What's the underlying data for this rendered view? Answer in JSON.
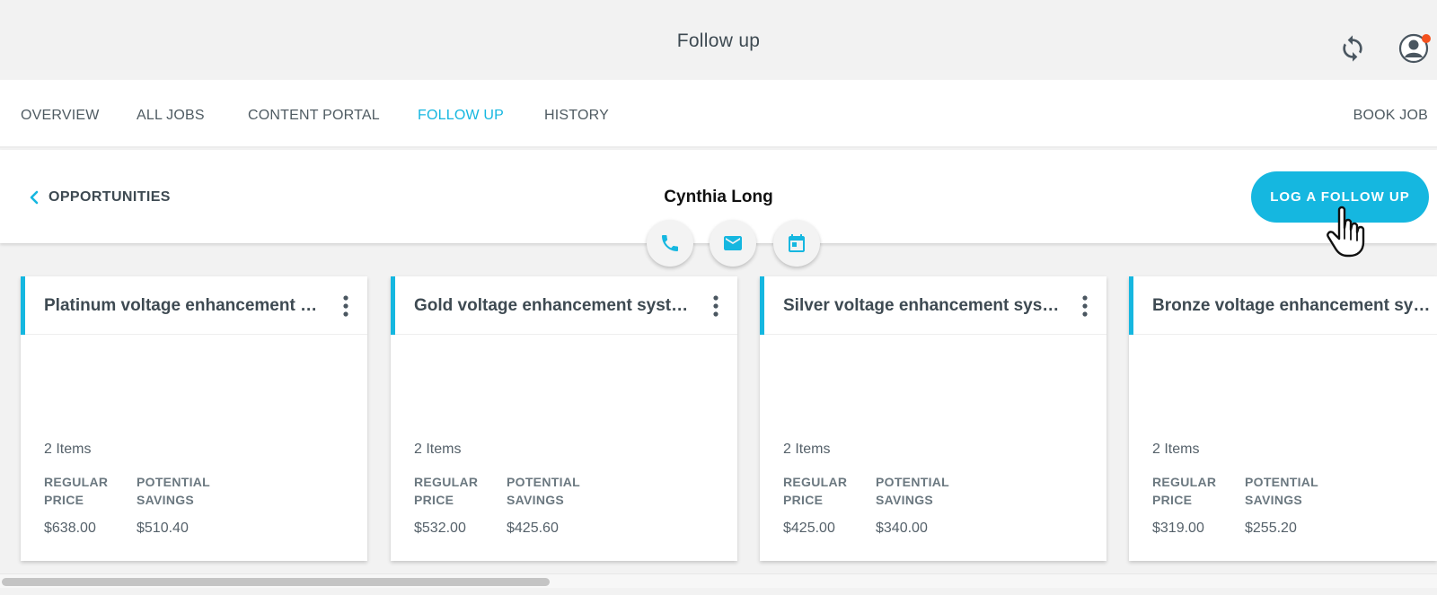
{
  "header": {
    "title": "Follow up"
  },
  "nav": {
    "items": [
      {
        "label": "OVERVIEW"
      },
      {
        "label": "ALL JOBS"
      },
      {
        "label": "CONTENT PORTAL"
      },
      {
        "label": "FOLLOW UP"
      },
      {
        "label": "HISTORY"
      }
    ],
    "active": "FOLLOW UP",
    "book_job": "BOOK JOB"
  },
  "subheader": {
    "back_label": "OPPORTUNITIES",
    "name": "Cynthia Long",
    "log_button": "LOG A FOLLOW UP"
  },
  "actions": [
    "phone-icon",
    "email-icon",
    "calendar-icon"
  ],
  "cards": [
    {
      "title": "Platinum voltage enhancement system",
      "items": "2 Items",
      "regular_label": "REGULAR PRICE",
      "savings_label": "POTENTIAL SAVINGS",
      "regular": "$638.00",
      "savings": "$510.40"
    },
    {
      "title": "Gold voltage enhancement system",
      "items": "2 Items",
      "regular_label": "REGULAR PRICE",
      "savings_label": "POTENTIAL SAVINGS",
      "regular": "$532.00",
      "savings": "$425.60"
    },
    {
      "title": "Silver voltage enhancement system",
      "items": "2 Items",
      "regular_label": "REGULAR PRICE",
      "savings_label": "POTENTIAL SAVINGS",
      "regular": "$425.00",
      "savings": "$340.00"
    },
    {
      "title": "Bronze voltage enhancement system",
      "items": "2 Items",
      "regular_label": "REGULAR PRICE",
      "savings_label": "POTENTIAL SAVINGS",
      "regular": "$319.00",
      "savings": "$255.20"
    }
  ],
  "colors": {
    "accent": "#15b7e0",
    "notification": "#f4511e"
  }
}
